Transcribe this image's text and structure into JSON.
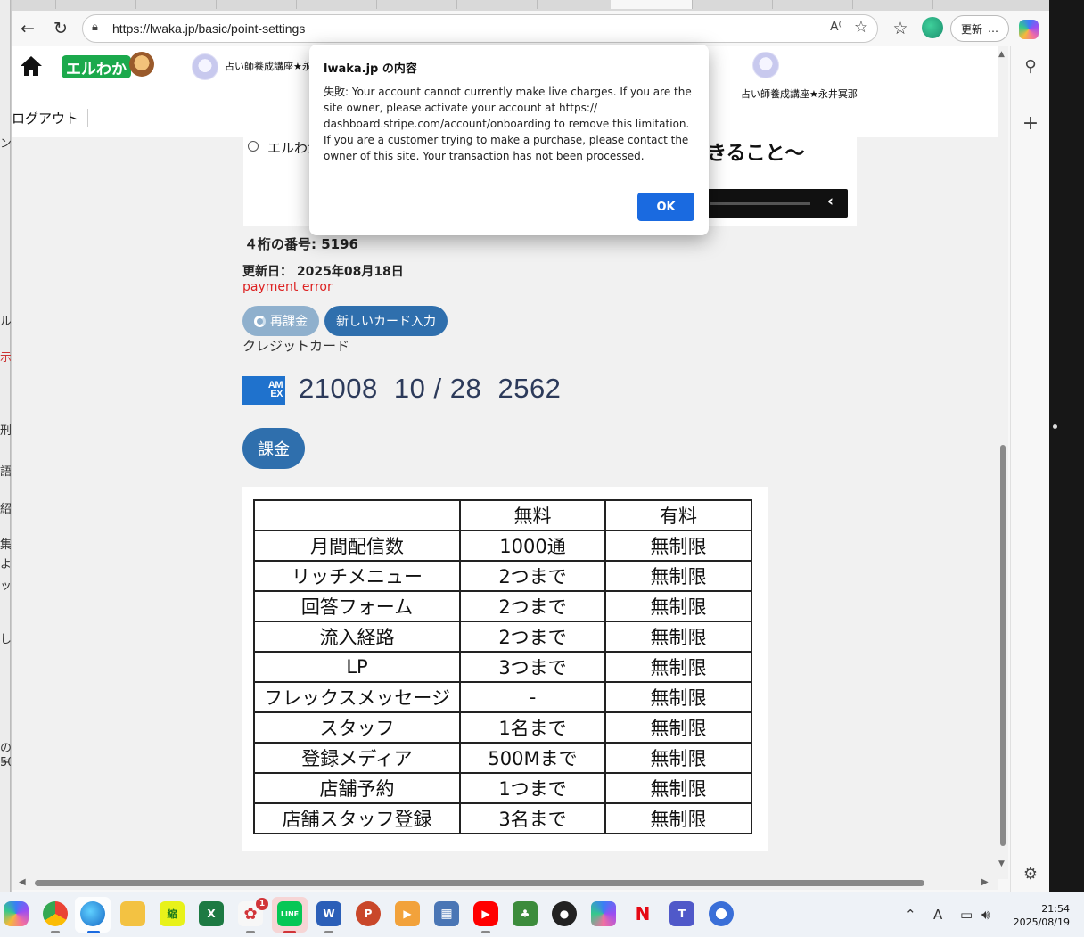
{
  "browser": {
    "url": "https://lwaka.jp/basic/point-settings",
    "update_label": "更新",
    "more_label": "…"
  },
  "left_strip": [
    "ン",
    "ル",
    "示",
    "刑",
    "語",
    "紹",
    "集",
    "よ",
    "ッ",
    "し",
    "の=",
    "50"
  ],
  "site": {
    "logo_text": "エルわか",
    "account_name": "占い師養成講座★永井冥那",
    "logout_label": "ログアウト",
    "radio_label": "エルわか",
    "headline_tail": "きること～"
  },
  "alert": {
    "title": "lwaka.jp の内容",
    "message": "失敗: Your account cannot currently make live charges. If you are the site owner, please activate your account at https:// dashboard.stripe.com/account/onboarding to remove this limitation. If you are a customer trying to make a purchase, please contact the owner of this site. Your transaction has not been processed.",
    "ok_label": "OK"
  },
  "billing": {
    "four_digit_label": "４桁の番号: 5196",
    "updated_label": "更新日：  2025年08月18日",
    "status": "payment error",
    "recharge_label": "再課金",
    "new_card_label": "新しいカード入力",
    "credit_card_label": "クレジットカード",
    "card_brand_line1": "AM",
    "card_brand_line2": "EX",
    "card_number": "21008  10 / 28  2562",
    "charge_label": "課金"
  },
  "plan_table": {
    "headers": [
      "",
      "無料",
      "有料"
    ],
    "rows": [
      [
        "月間配信数",
        "1000通",
        "無制限"
      ],
      [
        "リッチメニュー",
        "2つまで",
        "無制限"
      ],
      [
        "回答フォーム",
        "2つまで",
        "無制限"
      ],
      [
        "流入経路",
        "2つまで",
        "無制限"
      ],
      [
        "LP",
        "3つまで",
        "無制限"
      ],
      [
        "フレックスメッセージ",
        "-",
        "無制限"
      ],
      [
        "スタッフ",
        "1名まで",
        "無制限"
      ],
      [
        "登録メディア",
        "500Mまで",
        "無制限"
      ],
      [
        "店舗予約",
        "1つまで",
        "無制限"
      ],
      [
        "店舗スタッフ登録",
        "3名まで",
        "無制限"
      ]
    ]
  },
  "taskbar": {
    "notification_badge": "1",
    "time": "21:54",
    "date": "2025/08/19",
    "ime_label": "A"
  },
  "colors": {
    "primary_button": "#2f6fad",
    "error_text": "#dd2222",
    "dialog_ok": "#1a6ae0",
    "logo_green": "#1ba94c"
  }
}
